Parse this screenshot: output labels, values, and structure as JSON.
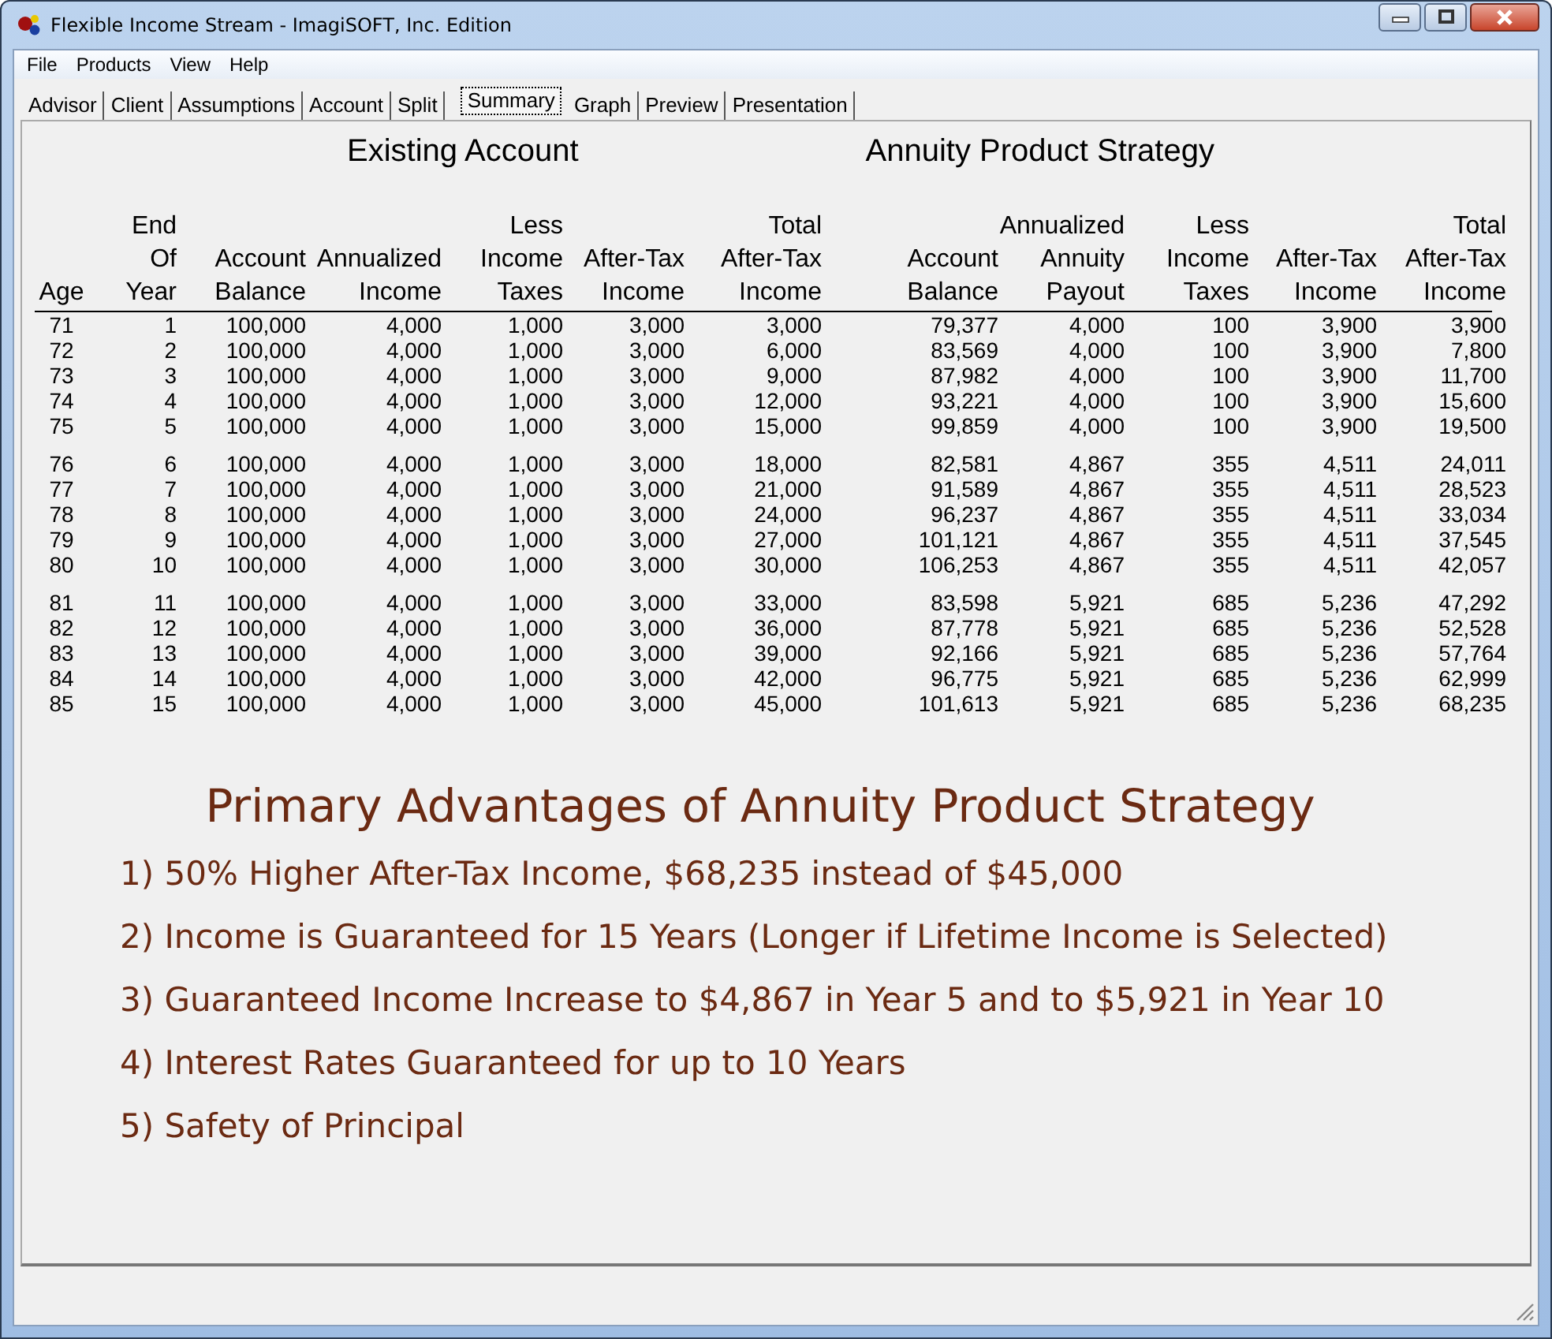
{
  "window": {
    "title": "Flexible Income Stream - ImagiSOFT, Inc. Edition"
  },
  "menu": [
    "File",
    "Products",
    "View",
    "Help"
  ],
  "tabs": [
    {
      "label": "Advisor",
      "selected": false
    },
    {
      "label": "Client",
      "selected": false
    },
    {
      "label": "Assumptions",
      "selected": false
    },
    {
      "label": "Account",
      "selected": false
    },
    {
      "label": "Split",
      "selected": false
    },
    {
      "label": "Summary",
      "selected": true
    },
    {
      "label": "Graph",
      "selected": false
    },
    {
      "label": "Preview",
      "selected": false
    },
    {
      "label": "Presentation",
      "selected": false
    }
  ],
  "sections": [
    "Existing Account",
    "Annuity Product Strategy"
  ],
  "table": {
    "columns": [
      [
        "Age"
      ],
      [
        "End",
        "Of",
        "Year"
      ],
      [
        "Account",
        "Balance"
      ],
      [
        "Annualized",
        "Income"
      ],
      [
        "Less",
        "Income",
        "Taxes"
      ],
      [
        "After-Tax",
        "Income"
      ],
      [
        "Total",
        "After-Tax",
        "Income"
      ],
      [
        "Account",
        "Balance"
      ],
      [
        "Annualized",
        "Annuity",
        "Payout"
      ],
      [
        "Less",
        "Income",
        "Taxes"
      ],
      [
        "After-Tax",
        "Income"
      ],
      [
        "Total",
        "After-Tax",
        "Income"
      ]
    ],
    "row_groups": [
      [
        [
          "71",
          "1",
          "100,000",
          "4,000",
          "1,000",
          "3,000",
          "3,000",
          "79,377",
          "4,000",
          "100",
          "3,900",
          "3,900"
        ],
        [
          "72",
          "2",
          "100,000",
          "4,000",
          "1,000",
          "3,000",
          "6,000",
          "83,569",
          "4,000",
          "100",
          "3,900",
          "7,800"
        ],
        [
          "73",
          "3",
          "100,000",
          "4,000",
          "1,000",
          "3,000",
          "9,000",
          "87,982",
          "4,000",
          "100",
          "3,900",
          "11,700"
        ],
        [
          "74",
          "4",
          "100,000",
          "4,000",
          "1,000",
          "3,000",
          "12,000",
          "93,221",
          "4,000",
          "100",
          "3,900",
          "15,600"
        ],
        [
          "75",
          "5",
          "100,000",
          "4,000",
          "1,000",
          "3,000",
          "15,000",
          "99,859",
          "4,000",
          "100",
          "3,900",
          "19,500"
        ]
      ],
      [
        [
          "76",
          "6",
          "100,000",
          "4,000",
          "1,000",
          "3,000",
          "18,000",
          "82,581",
          "4,867",
          "355",
          "4,511",
          "24,011"
        ],
        [
          "77",
          "7",
          "100,000",
          "4,000",
          "1,000",
          "3,000",
          "21,000",
          "91,589",
          "4,867",
          "355",
          "4,511",
          "28,523"
        ],
        [
          "78",
          "8",
          "100,000",
          "4,000",
          "1,000",
          "3,000",
          "24,000",
          "96,237",
          "4,867",
          "355",
          "4,511",
          "33,034"
        ],
        [
          "79",
          "9",
          "100,000",
          "4,000",
          "1,000",
          "3,000",
          "27,000",
          "101,121",
          "4,867",
          "355",
          "4,511",
          "37,545"
        ],
        [
          "80",
          "10",
          "100,000",
          "4,000",
          "1,000",
          "3,000",
          "30,000",
          "106,253",
          "4,867",
          "355",
          "4,511",
          "42,057"
        ]
      ],
      [
        [
          "81",
          "11",
          "100,000",
          "4,000",
          "1,000",
          "3,000",
          "33,000",
          "83,598",
          "5,921",
          "685",
          "5,236",
          "47,292"
        ],
        [
          "82",
          "12",
          "100,000",
          "4,000",
          "1,000",
          "3,000",
          "36,000",
          "87,778",
          "5,921",
          "685",
          "5,236",
          "52,528"
        ],
        [
          "83",
          "13",
          "100,000",
          "4,000",
          "1,000",
          "3,000",
          "39,000",
          "92,166",
          "5,921",
          "685",
          "5,236",
          "57,764"
        ],
        [
          "84",
          "14",
          "100,000",
          "4,000",
          "1,000",
          "3,000",
          "42,000",
          "96,775",
          "5,921",
          "685",
          "5,236",
          "62,999"
        ],
        [
          "85",
          "15",
          "100,000",
          "4,000",
          "1,000",
          "3,000",
          "45,000",
          "101,613",
          "5,921",
          "685",
          "5,236",
          "68,235"
        ]
      ]
    ]
  },
  "advantages": {
    "title": "Primary Advantages of Annuity Product Strategy",
    "items": [
      "1) 50% Higher After-Tax Income, $68,235 instead of $45,000",
      "2) Income is Guaranteed for 15 Years (Longer if Lifetime Income is Selected)",
      "3) Guaranteed Income Increase to $4,867 in Year 5 and to $5,921 in Year 10",
      "4) Interest Rates Guaranteed for up to 10 Years",
      "5) Safety of Principal"
    ]
  }
}
